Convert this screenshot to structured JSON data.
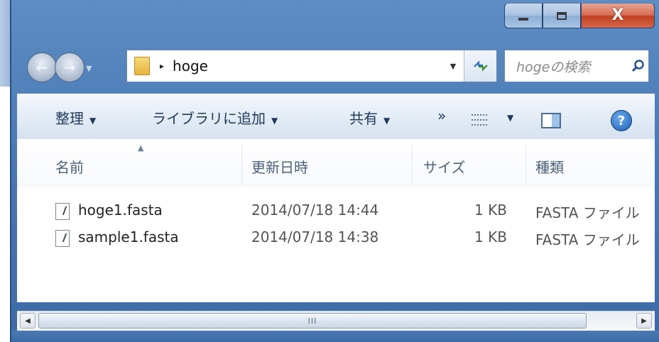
{
  "window": {
    "caption_min": "—",
    "caption_max": "□",
    "caption_close": "X"
  },
  "address_bar": {
    "arrow": "▸",
    "path": "hoge",
    "dropdown": "▼",
    "refresh": "⁴↻"
  },
  "search": {
    "placeholder": "hogeの検索"
  },
  "toolbar": {
    "organize": "整理",
    "add_to_library": "ライブラリに追加",
    "share": "共有",
    "more": "»",
    "caret": "▼",
    "help": "?"
  },
  "columns": {
    "name": "名前",
    "modified": "更新日時",
    "size": "サイズ",
    "type": "種類",
    "sort_indicator": "▲"
  },
  "files": [
    {
      "name": "hoge1.fasta",
      "modified": "2014/07/18 14:44",
      "size": "1 KB",
      "type": "FASTA ファイル"
    },
    {
      "name": "sample1.fasta",
      "modified": "2014/07/18 14:38",
      "size": "1 KB",
      "type": "FASTA ファイル"
    }
  ],
  "scrollbar": {
    "left_arrow": "◀",
    "right_arrow": "▶",
    "thumb_grip": "III"
  }
}
